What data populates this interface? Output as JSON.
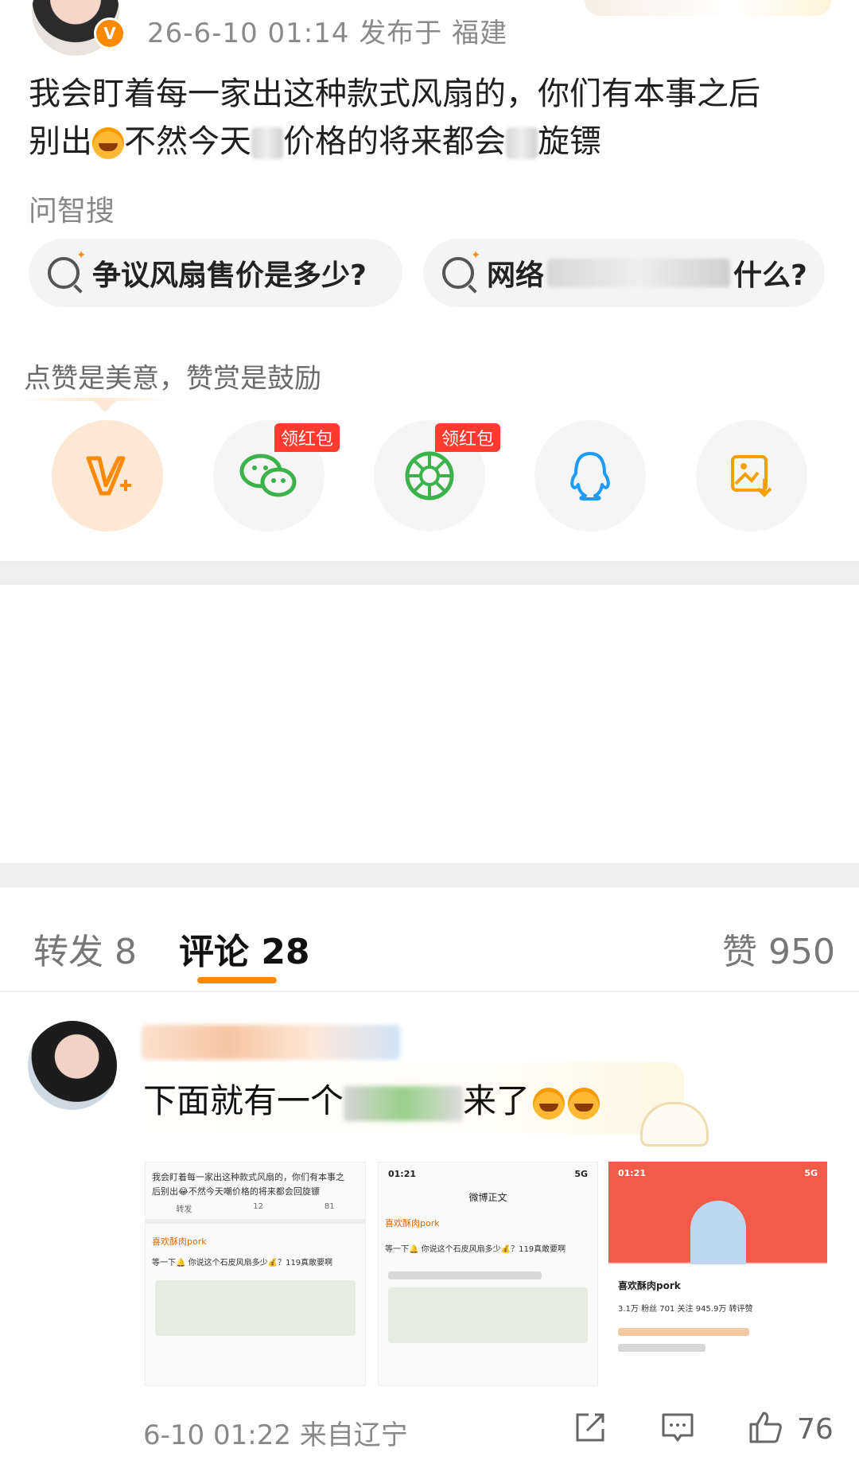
{
  "post": {
    "meta": "26-6-10 01:14  发布于 福建",
    "text_line1": "我会盯着每一家出这种款式风扇的，你们有本事之后",
    "text_line2_a": "别出",
    "text_line2_b": "不然今天",
    "text_line2_c": "价格的将来都会",
    "text_line2_d": "旋镖"
  },
  "search": {
    "heading": "问智搜",
    "chips": [
      {
        "label": "争议风扇售价是多少?"
      },
      {
        "label_start": "网络",
        "label_end": "什么?"
      }
    ]
  },
  "share": {
    "encourage_text": "点赞是美意，赞赏是鼓励",
    "red_packet_label": "领红包",
    "icons": [
      "weibo-v-plus-icon",
      "wechat-icon",
      "moments-icon",
      "qq-icon",
      "save-image-icon"
    ]
  },
  "tabs": {
    "repost": "转发 8",
    "comments": "评论 28",
    "likes": "赞 950"
  },
  "comment": {
    "text_a": "下面就有一个",
    "text_b": "来了",
    "meta": "6-10 01:22  来自辽宁",
    "like_count": "76",
    "thumb1": {
      "line1": "我会盯着每一家出这种款式风扇的，你们有本事之",
      "line2": "后别出😂不然今天嘲价格的将来都会回旋镖",
      "repost": "转发",
      "comments": "12",
      "likes": "81",
      "user": "喜欢酥肉pork",
      "reply": "等一下🔔 你说这个石皮风扇多少💰？119真敢要啊"
    },
    "thumb2": {
      "time": "01:21",
      "signal": "5G",
      "title": "微博正文",
      "user": "喜欢酥肉pork",
      "reply": "等一下🔔 你说这个石皮风扇多少💰？119真敢要啊"
    },
    "thumb3": {
      "time": "01:21",
      "signal": "5G",
      "user": "喜欢酥肉pork",
      "stats": "3.1万 粉丝   701 关注   945.9万 转评赞"
    }
  }
}
